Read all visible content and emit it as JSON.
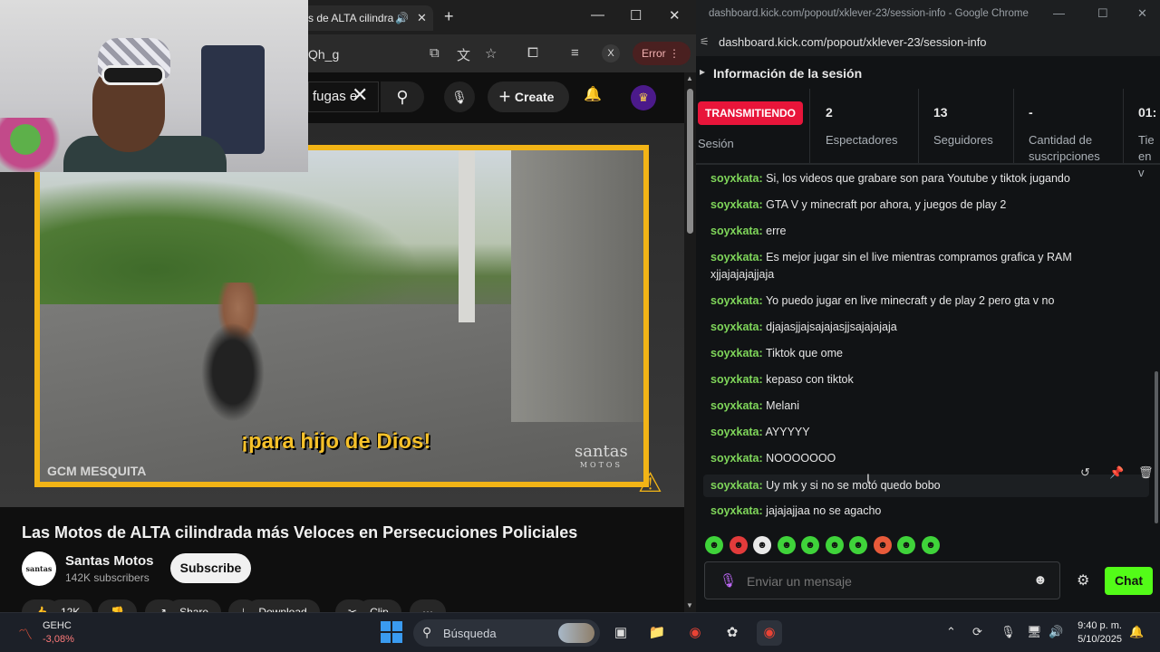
{
  "youtube": {
    "tab_title": "s de ALTA cilindra",
    "url_fragment": "Qh_g",
    "error_label": "Error",
    "profile_initial": "X",
    "search_value": "fugas e",
    "create_label": "Create",
    "video": {
      "caption": "¡para hijo de Dios!",
      "watermark_left": "GCM MESQUITA",
      "watermark_right": "santas",
      "watermark_right_sub": "MOTOS"
    },
    "title": "Las Motos de ALTA cilindrada más Veloces en Persecuciones Policiales",
    "channel": {
      "name": "Santas Motos",
      "subscribers": "142K subscribers",
      "avatar_text": "santas"
    },
    "subscribe_label": "Subscribe",
    "actions": [
      "12K",
      "",
      "Share",
      "Download",
      "Clip",
      ""
    ]
  },
  "kick": {
    "window_title": "dashboard.kick.com/popout/xklever-23/session-info - Google Chrome",
    "url": "dashboard.kick.com/popout/xklever-23/session-info",
    "section_title": "Información de la sesión",
    "live_badge": "TRANSMITIENDO",
    "stats": [
      {
        "value": "",
        "label": "Sesión"
      },
      {
        "value": "2",
        "label": "Espectadores"
      },
      {
        "value": "13",
        "label": "Seguidores"
      },
      {
        "value": "-",
        "label": "Cantidad de suscripciones"
      },
      {
        "value": "01:",
        "label": "Tie en v"
      }
    ],
    "messages": [
      {
        "user": "soyxkata:",
        "text": "Si, los videos que grabare son para Youtube y tiktok jugando"
      },
      {
        "user": "soyxkata:",
        "text": "GTA V y minecraft por ahora, y juegos de play 2"
      },
      {
        "user": "soyxkata:",
        "text": "erre"
      },
      {
        "user": "soyxkata:",
        "text": "Es mejor jugar sin el live mientras compramos grafica y RAM xjjajajajajjaja"
      },
      {
        "user": "soyxkata:",
        "text": "Yo puedo jugar en live minecraft y de play 2 pero gta v no"
      },
      {
        "user": "soyxkata:",
        "text": "djajasjjajsajajasjjsajajajaja"
      },
      {
        "user": "soyxkata:",
        "text": "Tiktok que ome"
      },
      {
        "user": "soyxkata:",
        "text": "kepaso con tiktok"
      },
      {
        "user": "soyxkata:",
        "text": "Melani"
      },
      {
        "user": "soyxkata:",
        "text": "AYYYYY"
      },
      {
        "user": "soyxkata:",
        "text": "NOOOOOOO"
      },
      {
        "user": "soyxkata:",
        "text": "Uy mk y si no se motó quedo bobo"
      },
      {
        "user": "soyxkata:",
        "text": "jajajajjaa no se agacho"
      }
    ],
    "input_placeholder": "Enviar un mensaje",
    "chat_button": "Chat",
    "emote_colors": [
      "#3fd33a",
      "#e23b3b",
      "#e9e9e9",
      "#3fd33a",
      "#3fd33a",
      "#3fd33a",
      "#3fd33a",
      "#e85a3a",
      "#3fd33a",
      "#3fd33a"
    ],
    "accent": "#53fc18",
    "username_color": "#7fd65a"
  },
  "taskbar": {
    "stock_name": "GEHC",
    "stock_change": "-3,08%",
    "search_label": "Búsqueda",
    "time": "9:40 p. m.",
    "date": "5/10/2025"
  }
}
